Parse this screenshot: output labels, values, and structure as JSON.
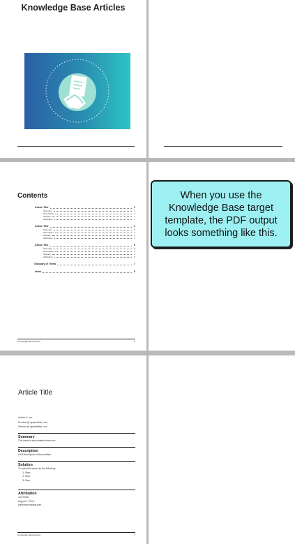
{
  "cover": {
    "title": "Knowledge Base Articles"
  },
  "callout": {
    "text": "When you use the Knowledge Base target template, the PDF output looks something like this."
  },
  "contents": {
    "heading": "Contents",
    "article_blocks": [
      {
        "title": "Article Title",
        "page": "1",
        "sub": [
          {
            "label": "Summary",
            "page": "1"
          },
          {
            "label": "Description",
            "page": "1"
          },
          {
            "label": "Solution",
            "page": "1"
          },
          {
            "label": "Attribution",
            "page": "1"
          }
        ]
      },
      {
        "title": "Article Title",
        "page": "3",
        "sub": [
          {
            "label": "Summary",
            "page": "3"
          },
          {
            "label": "Description",
            "page": "3"
          },
          {
            "label": "Solution",
            "page": "3"
          },
          {
            "label": "Attribution",
            "page": "3"
          }
        ]
      },
      {
        "title": "Article Title",
        "page": "5",
        "sub": [
          {
            "label": "Summary",
            "page": "5"
          },
          {
            "label": "Description",
            "page": "5"
          },
          {
            "label": "Solution",
            "page": "5"
          },
          {
            "label": "Attribution",
            "page": "5"
          }
        ]
      }
    ],
    "glossary": {
      "label": "Glossary of Terms",
      "page": "7"
    },
    "index": {
      "label": "Index",
      "page": "8"
    }
  },
  "footer_left": "Knowledge Base Articles",
  "footer_contents_page": "iii",
  "footer_article_page": "1",
  "article": {
    "title": "Article Title",
    "meta": [
      "Article #: xxx",
      "Product (if applicable): xxx",
      "Version (if applicable): xxx"
    ],
    "summary_heading": "Summary",
    "summary_text": "This issue is encountered when xxx.",
    "description_heading": "Description",
    "description_text": "A full description of the problem.",
    "solution_heading": "Solution",
    "solution_text": "To solve this issue, do the following:",
    "steps": [
      "Step",
      "Step",
      "Step"
    ],
    "attribution_heading": "Attribution",
    "attribution_lines": [
      "Joe Smith",
      "August 7, 2016",
      "joe@mycompany.com"
    ]
  },
  "colors": {
    "callout_bg": "#9cf0f2",
    "art_start": "#2a5fa6",
    "art_end": "#2cc4c4"
  }
}
